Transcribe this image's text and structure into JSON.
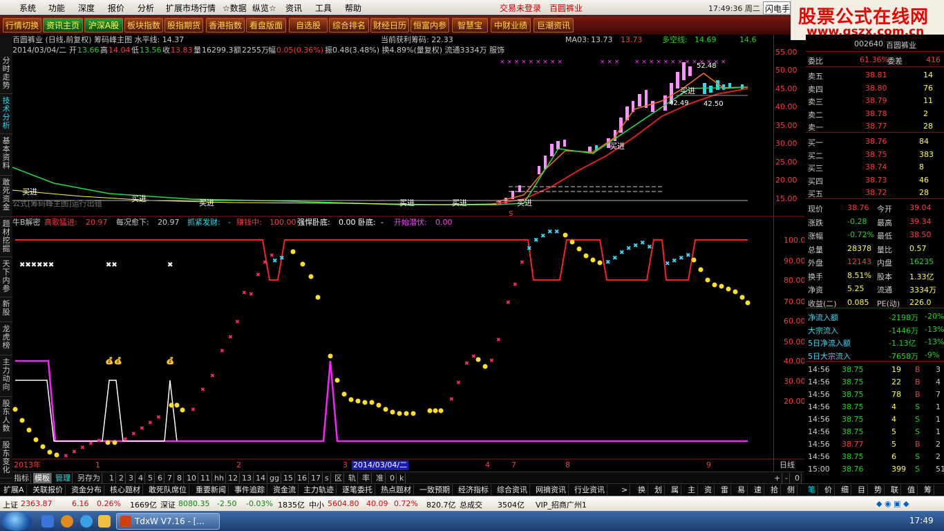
{
  "menu": {
    "items": [
      "系统",
      "功能",
      "深度",
      "报价",
      "分析",
      "扩展市场行情",
      "☆数据",
      "纵览☆",
      "资讯",
      "工具",
      "帮助"
    ],
    "warn1": "交易未登录",
    "warn2": "百圆裤业",
    "clock": "17:49:36 周二",
    "flash": "闪电手"
  },
  "brand": {
    "line1": "股票公式在线网",
    "line2": "www.gszx.com.cn"
  },
  "toolbar": [
    "行情切换",
    "资讯主页",
    "沪深A股",
    "板块指数",
    "股指期货",
    "香港指数",
    "看盘版面",
    "自选股",
    "综合排名",
    "财经日历",
    "恒富内参",
    "智慧宝",
    "中财业绩",
    "巨潮资讯"
  ],
  "lefttabs": [
    "分时走势",
    "技术分析",
    "基本资料",
    "敢死资金",
    "题材挖掘",
    "天下内参",
    "新股",
    "龙虎榜",
    "主力动向",
    "股东人数",
    "股东变化"
  ],
  "main": {
    "title": "百圆裤业 (日线,前复权) 筹码峰主图 水平线: 14.37",
    "profit": "当前获利筹码: 22.33",
    "ma03_label": "MA03:",
    "ma03_v1": "13.73",
    "ma03_v2": "13.73",
    "dk_label": "多空线:",
    "dk_v1": "14.69",
    "dk_v2": "14.6",
    "date": "2014/03/04/二",
    "open_l": "开",
    "open": "13.66",
    "high_l": "高",
    "high": "14.04",
    "low_l": "低",
    "low": "13.56",
    "close_l": "收",
    "close": "13.83",
    "vol_l": "量",
    "vol": "16299.3",
    "amt_l": "额",
    "amt": "2255万",
    "chg_l": "幅",
    "chg": "0.05(0.36%)",
    "rest": "振0.48(3.48%)  换4.89%(量复权) 流通3334万 服饰",
    "formula": "公式[筹码峰主图]运行出错",
    "prices": [
      "55.00",
      "50.00",
      "45.00",
      "40.00",
      "35.00",
      "30.00",
      "25.00",
      "20.00",
      "15.00"
    ],
    "hi_label": "52.48",
    "lo_label1": "42.49",
    "lo_label2": "42.50",
    "buy": "买进"
  },
  "sub": {
    "name": "牛B解密",
    "a_l": "高歌猛进:",
    "a": "20.97",
    "b_l": "每况愈下:",
    "b": "20.97",
    "c_l": "抓紧发财:",
    "c": "-",
    "d_l": "赚钱中:",
    "d": "100.00",
    "e_l": "强悍卧底:",
    "e": "0.00",
    "f_l": "卧底:",
    "f": "-",
    "g_l": "开始潜伏:",
    "g": "0.00",
    "levels": [
      "100.0",
      "90.00",
      "80.00",
      "70.00",
      "60.00",
      "50.00",
      "40.00",
      "30.00",
      "20.00"
    ],
    "x_labels": [
      "2013年",
      "1",
      "2",
      "3",
      "2014/03/04/二",
      "4",
      "7",
      "8",
      "9"
    ],
    "period": "日线"
  },
  "quote": {
    "code": "002640",
    "name": "百圆裤业",
    "wb_l": "委比",
    "wb": "61.36%",
    "wc_l": "委差",
    "wc": "416",
    "asks": [
      [
        "卖五",
        "38.81",
        "14"
      ],
      [
        "卖四",
        "38.80",
        "76"
      ],
      [
        "卖三",
        "38.79",
        "11"
      ],
      [
        "卖二",
        "38.78",
        "2"
      ],
      [
        "卖一",
        "38.77",
        "28"
      ]
    ],
    "bids": [
      [
        "买一",
        "38.76",
        "84"
      ],
      [
        "买二",
        "38.75",
        "383"
      ],
      [
        "买三",
        "38.74",
        "8"
      ],
      [
        "买四",
        "38.73",
        "46"
      ],
      [
        "买五",
        "38.72",
        "28"
      ]
    ],
    "stats": [
      [
        "现价",
        "38.76",
        "今开",
        "39.04"
      ],
      [
        "涨跌",
        "-0.28",
        "最高",
        "39.34"
      ],
      [
        "涨幅",
        "-0.72%",
        "最低",
        "38.50"
      ],
      [
        "总量",
        "28378",
        "量比",
        "0.57"
      ],
      [
        "外盘",
        "12143",
        "内盘",
        "16235"
      ],
      [
        "换手",
        "8.51%",
        "股本",
        "1.33亿"
      ],
      [
        "净资",
        "5.25",
        "流通",
        "3334万"
      ],
      [
        "收益(二)",
        "0.085",
        "PE(动)",
        "226.0"
      ]
    ],
    "flows": [
      [
        "净流入额",
        "-2198万",
        "-20%"
      ],
      [
        "大宗流入",
        "-1446万",
        "-13%"
      ],
      [
        "5日净流入额",
        "-1.13亿",
        "-13%"
      ],
      [
        "5日大宗流入",
        "-7658万",
        "-9%"
      ]
    ],
    "ticks": [
      [
        "14:56",
        "38.75",
        "19",
        "B",
        "3"
      ],
      [
        "14:56",
        "38.75",
        "22",
        "B",
        "4"
      ],
      [
        "14:56",
        "38.75",
        "78",
        "B",
        "7"
      ],
      [
        "14:56",
        "38.75",
        "4",
        "S",
        "1"
      ],
      [
        "14:56",
        "38.75",
        "4",
        "S",
        "1"
      ],
      [
        "14:56",
        "38.75",
        "5",
        "S",
        "1"
      ],
      [
        "14:56",
        "38.77",
        "5",
        "B",
        "2"
      ],
      [
        "14:56",
        "38.75",
        "6",
        "S",
        "2"
      ],
      [
        "15:00",
        "38.76",
        "399",
        "S",
        "51"
      ]
    ]
  },
  "bottomtabs": [
    "指标",
    "模板",
    "管理",
    "另存为",
    "1",
    "2",
    "3",
    "4",
    "5",
    "6",
    "7",
    "8",
    "10",
    "11",
    "hh",
    "12",
    "13",
    "14",
    "gg",
    "15",
    "16",
    "17",
    "s",
    "区",
    "轨",
    "率",
    "准",
    "0",
    "k"
  ],
  "zoom": [
    "+",
    "-",
    "0"
  ],
  "funcrow": [
    "扩展A",
    "关联报价",
    "资金分布",
    "核心题材",
    "敢死队席位",
    "重要新闻",
    "事件追踪",
    "资金流",
    "主力轨迹",
    "逐笔委托",
    "热点题材",
    "一致预期",
    "经济指标",
    "综合资讯",
    "网摘资讯",
    "行业资讯"
  ],
  "funcright": [
    "换",
    "划",
    "属",
    "主",
    "资",
    "雷",
    "易",
    "速",
    "拾",
    "侧"
  ],
  "rightbottom": [
    "笔",
    "价",
    "细",
    "目",
    "势",
    "联",
    "值",
    "筹"
  ],
  "status": {
    "sh_l": "上证",
    "sh": "2363.87",
    "sh_c": "6.16",
    "sh_p": "0.26%",
    "sh_a": "1669亿",
    "sz_l": "深证",
    "sz": "8080.35",
    "sz_c": "-2.50",
    "sz_p": "-0.03%",
    "sz_a": "1835亿",
    "zx_l": "中小",
    "zx": "5604.80",
    "zx_c": "40.09",
    "zx_p": "0.72%",
    "zx_a": "820.7亿",
    "tot_l": "总成交",
    "tot": "3504亿",
    "vip": "VIP_招商广州1"
  },
  "taskbar": {
    "app": "TdxW V7.16 - [...",
    "clock": "17:49"
  }
}
